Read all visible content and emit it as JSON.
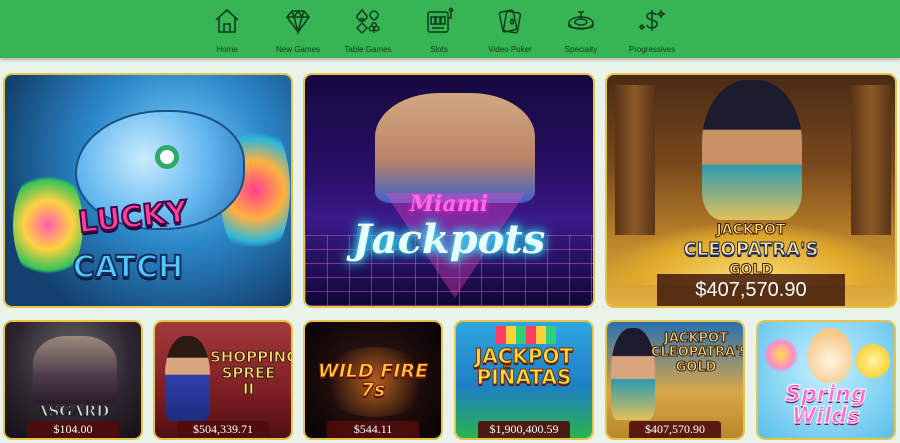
{
  "nav": {
    "items": [
      {
        "label": "Home",
        "icon": "home-icon"
      },
      {
        "label": "New Games",
        "icon": "diamond-icon"
      },
      {
        "label": "Table Games",
        "icon": "card-suits-icon"
      },
      {
        "label": "Slots",
        "icon": "slot-machine-icon"
      },
      {
        "label": "Video Poker",
        "icon": "playing-cards-icon"
      },
      {
        "label": "Specialty",
        "icon": "roulette-icon"
      },
      {
        "label": "Progressives",
        "icon": "dollar-sparkle-icon"
      }
    ]
  },
  "featured": [
    {
      "title_line1": "LUCKY",
      "title_line2": "CATCH",
      "jackpot": ""
    },
    {
      "title_line1": "Miami",
      "title_line2": "Jackpots",
      "jackpot": ""
    },
    {
      "title_line1": "JACKPOT",
      "title_line2": "CLEOPATRA'S",
      "title_line3": "GOLD",
      "jackpot": "$407,570.90"
    }
  ],
  "games": [
    {
      "title": "ASGARD",
      "jackpot": "$104.00"
    },
    {
      "title": "SHOPPING SPREE II",
      "jackpot": "$504,339.71"
    },
    {
      "title": "WILD FIRE 7s",
      "jackpot": "$544.11"
    },
    {
      "title": "JACKPOT PIÑATAS",
      "jackpot": "$1,900,400.59"
    },
    {
      "title": "JACKPOT CLEOPATRA'S GOLD",
      "jackpot": "$407,570.90"
    },
    {
      "title": "Spring Wilds",
      "jackpot": ""
    }
  ],
  "colors": {
    "nav_bg": "#37b453",
    "page_bg": "#e9f3ea",
    "tile_border": "#e6c44a",
    "jackpot_bar": "#3c140a"
  }
}
